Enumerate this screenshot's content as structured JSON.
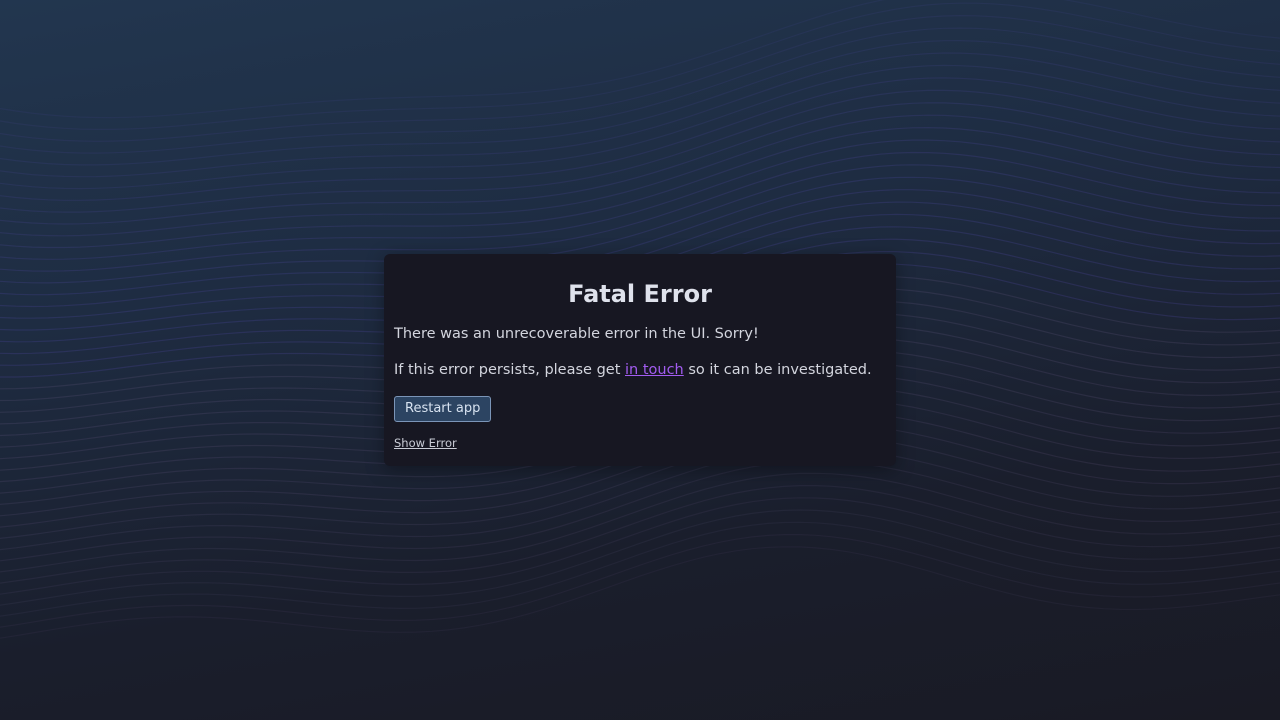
{
  "error": {
    "title": "Fatal Error",
    "message": "There was an unrecoverable error in the UI. Sorry!",
    "persist_prefix": "If this error persists, please get ",
    "persist_link": "in touch",
    "persist_suffix": " so it can be investigated.",
    "restart_label": "Restart app",
    "show_error_label": "Show Error"
  },
  "colors": {
    "link": "#a25cf0",
    "button_bg": "#2c4462",
    "dialog_bg": "#171722"
  }
}
